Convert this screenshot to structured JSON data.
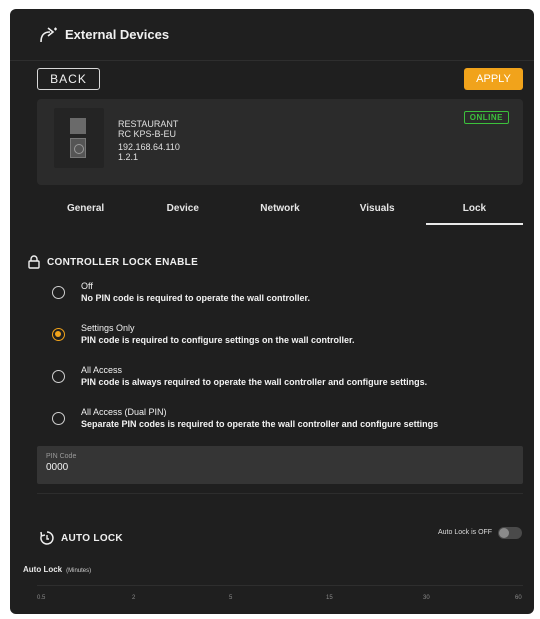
{
  "header": {
    "title": "External Devices",
    "icon": "external-link-icon"
  },
  "toolbar": {
    "back_label": "BACK",
    "apply_label": "APPLY",
    "apply_color": "#f1a31b"
  },
  "device": {
    "name": "RESTAURANT",
    "model": "RC KPS-B-EU",
    "ip": "192.168.64.110",
    "version": "1.2.1",
    "status": "ONLINE",
    "status_color": "#3cc13c"
  },
  "tabs": [
    {
      "label": "General"
    },
    {
      "label": "Device"
    },
    {
      "label": "Network"
    },
    {
      "label": "Visuals"
    },
    {
      "label": "Lock",
      "active": true
    }
  ],
  "lock": {
    "title": "CONTROLLER LOCK ENABLE",
    "options": [
      {
        "name": "Off",
        "desc": "No PIN code is required to operate the wall controller.",
        "checked": false
      },
      {
        "name": "Settings Only",
        "desc": "PIN code is required to configure settings on the wall controller.",
        "checked": true
      },
      {
        "name": "All Access",
        "desc": "PIN code is always required to operate the wall controller and configure settings.",
        "checked": false
      },
      {
        "name": "All Access (Dual PIN)",
        "desc": "Separate PIN codes is required to operate the wall controller and configure settings",
        "checked": false
      }
    ],
    "pin_label": "PIN Code",
    "pin_value": "0000"
  },
  "auto_lock": {
    "title": "AUTO LOCK",
    "status": "Auto Lock is OFF",
    "enabled": false,
    "label": "Auto Lock",
    "unit": "(Minutes)",
    "ticks": [
      "0.5",
      "2",
      "5",
      "15",
      "30",
      "60"
    ]
  }
}
